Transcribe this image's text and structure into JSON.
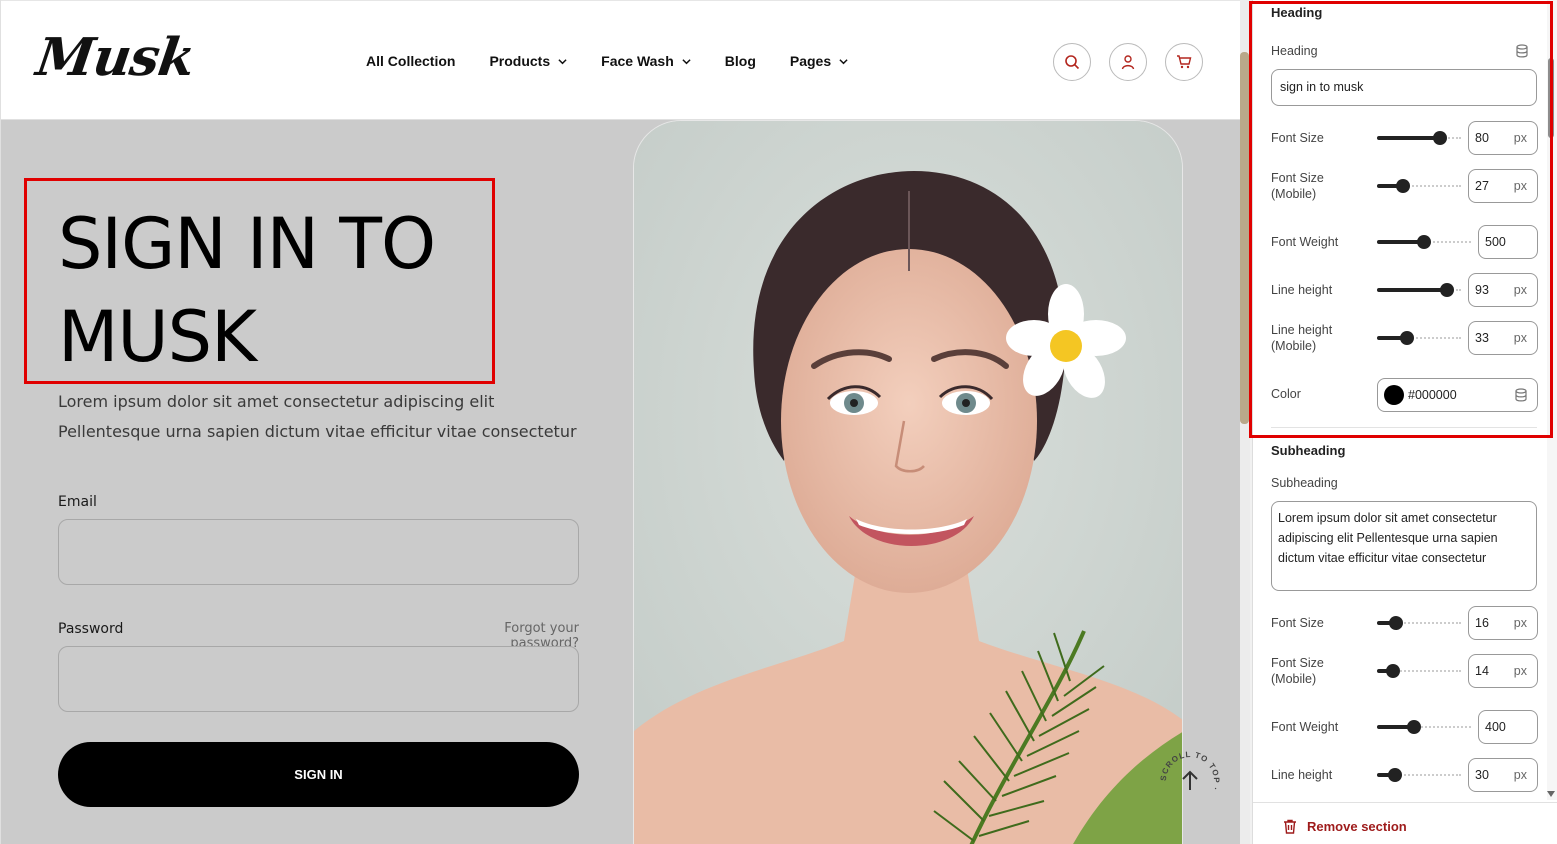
{
  "site": {
    "logo": "Musk",
    "nav": [
      {
        "label": "All Collection",
        "has_dropdown": false
      },
      {
        "label": "Products",
        "has_dropdown": true
      },
      {
        "label": "Face Wash",
        "has_dropdown": true
      },
      {
        "label": "Blog",
        "has_dropdown": false
      },
      {
        "label": "Pages",
        "has_dropdown": true
      }
    ],
    "header_icons": [
      "search-icon",
      "user-icon",
      "cart-icon"
    ],
    "accent_color": "#b3261e"
  },
  "login": {
    "heading": "sign in to musk",
    "subheading_line1": "Lorem ipsum dolor sit amet consectetur adipiscing elit",
    "subheading_line2": "Pellentesque urna sapien dictum vitae efficitur vitae consectetur",
    "email_label": "Email",
    "password_label": "Password",
    "forgot_link": "Forgot your password?",
    "submit_label": "SIGN IN",
    "scroll_top_label": "SCROLL TO TOP ·"
  },
  "panel": {
    "heading_section": {
      "title": "Heading",
      "field_label": "Heading",
      "field_value": "sign in to musk",
      "font_size": {
        "label": "Font Size",
        "value": "80",
        "unit": "px",
        "level": 0.75
      },
      "font_size_mobile": {
        "label": "Font Size\n(Mobile)",
        "label_line1": "Font Size",
        "label_line2": "(Mobile)",
        "value": "27",
        "unit": "px",
        "level": 0.31
      },
      "font_weight": {
        "label": "Font Weight",
        "value": "500",
        "level": 0.5
      },
      "line_height": {
        "label": "Line height",
        "value": "93",
        "unit": "px",
        "level": 0.83
      },
      "line_height_mobile": {
        "label_line1": "Line height",
        "label_line2": "(Mobile)",
        "value": "33",
        "unit": "px",
        "level": 0.36
      },
      "color": {
        "label": "Color",
        "value": "#000000"
      }
    },
    "subheading_section": {
      "title": "Subheading",
      "field_label": "Subheading",
      "field_value": "Lorem ipsum dolor sit amet consectetur adipiscing elit Pellentesque urna sapien dictum vitae efficitur vitae consectetur",
      "font_size": {
        "label": "Font Size",
        "value": "16",
        "unit": "px",
        "level": 0.23
      },
      "font_size_mobile": {
        "label_line1": "Font Size",
        "label_line2": "(Mobile)",
        "value": "14",
        "unit": "px",
        "level": 0.19
      },
      "font_weight": {
        "label": "Font Weight",
        "value": "400",
        "level": 0.39
      },
      "line_height": {
        "label": "Line height",
        "value": "30",
        "unit": "px",
        "level": 0.22
      }
    },
    "remove_label": "Remove section"
  }
}
